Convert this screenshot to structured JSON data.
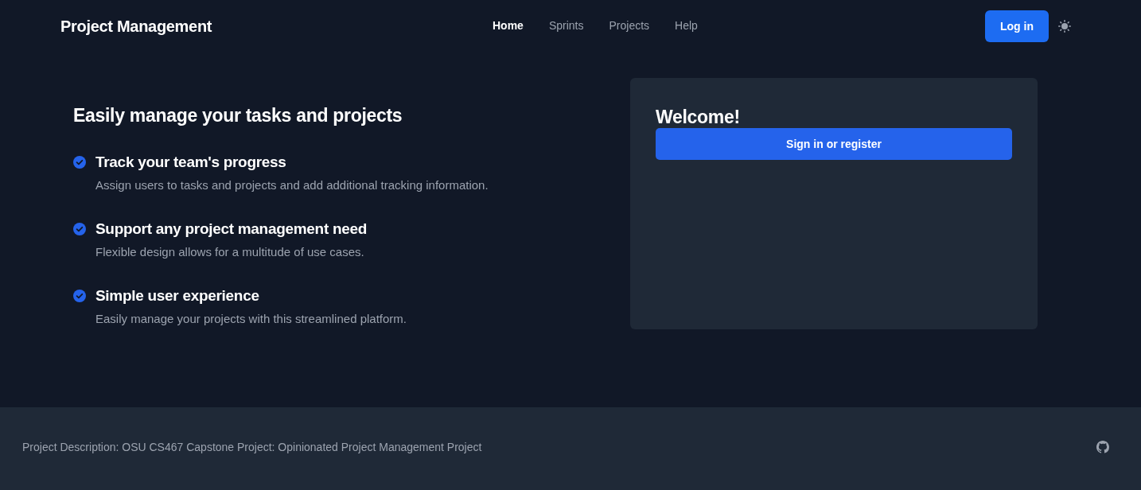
{
  "header": {
    "brand": "Project Management",
    "nav": [
      {
        "label": "Home",
        "selected": true
      },
      {
        "label": "Sprints",
        "selected": false
      },
      {
        "label": "Projects",
        "selected": false
      },
      {
        "label": "Help",
        "selected": false
      }
    ],
    "login_button": "Log in"
  },
  "hero": {
    "heading": "Easily manage your tasks and projects",
    "features": [
      {
        "title": "Track your team's progress",
        "description": "Assign users to tasks and projects and add additional tracking information."
      },
      {
        "title": "Support any project management need",
        "description": "Flexible design allows for a multitude of use cases."
      },
      {
        "title": "Simple user experience",
        "description": "Easily manage your projects with this streamlined platform."
      }
    ]
  },
  "card": {
    "title": "Welcome!",
    "button": "Sign in or register"
  },
  "footer": {
    "description": "Project Description: OSU CS467 Capstone Project: Opinionated Project Management Project"
  }
}
